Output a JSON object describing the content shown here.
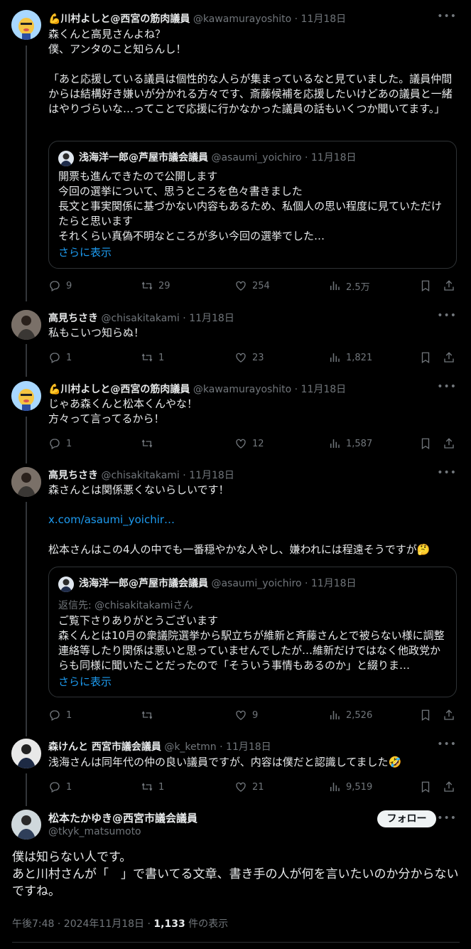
{
  "tweets": [
    {
      "emoji": "💪",
      "name": "川村よしと@西宮の筋肉議員",
      "handle": "@kawamurayoshito",
      "date": "11月18日",
      "text": "森くんと高見さんよね？\n僕、アンタのこと知らんし！\n\n「あと応援している議員は個性的な人らが集まっているなと見ていました。議員仲間からは結構好き嫌いが分かれる方々です、斎藤候補を応援したいけどあの議員と一緒はやりづらいな…ってことで応援に行かなかった議員の話もいくつか聞いてます。」",
      "quote": {
        "name": "浅海洋一郎@芦屋市議会議員",
        "handle": "@asaumi_yoichiro",
        "date": "11月18日",
        "text": "開票も進んできたので公開します\n今回の選挙について、思うところを色々書きました\n長文と事実関係に基づかない内容もあるため、私個人の思い程度に見ていただけたらと思います\nそれくらい真偽不明なところが多い今回の選挙でした…",
        "show_more": "さらに表示"
      },
      "stats": {
        "replies": "9",
        "retweets": "29",
        "likes": "254",
        "views": "2.5万"
      }
    },
    {
      "name": "高見ちさき",
      "handle": "@chisakitakami",
      "date": "11月18日",
      "text": "私もこいつ知らぬ！",
      "stats": {
        "replies": "1",
        "retweets": "1",
        "likes": "23",
        "views": "1,821"
      }
    },
    {
      "emoji": "💪",
      "name": "川村よしと@西宮の筋肉議員",
      "handle": "@kawamurayoshito",
      "date": "11月18日",
      "text": "じゃあ森くんと松本くんやな！\n方々って言ってるから！",
      "stats": {
        "replies": "1",
        "retweets": "",
        "likes": "12",
        "views": "1,587"
      }
    },
    {
      "name": "高見ちさき",
      "handle": "@chisakitakami",
      "date": "11月18日",
      "text": "森さんとは関係悪くないらしいです！",
      "link": "x.com/asaumi_yoichir…",
      "text2": "松本さんはこの4人の中でも一番穏やかな人やし、嫌われには程遠そうですが🤔",
      "quote": {
        "name": "浅海洋一郎@芦屋市議会議員",
        "handle": "@asaumi_yoichiro",
        "date": "11月18日",
        "reply_to": "返信先: @chisakitakamiさん",
        "text": "ご覧下さりありがとうございます\n森くんとは10月の衆議院選挙から駅立ちが維新と斉藤さんとで被らない様に調整連絡等したり関係は悪いと思っていませんでしたが…維新だけではなく他政党からも同様に聞いたことだったので「そういう事情もあるのか」と綴りま…",
        "show_more": "さらに表示"
      },
      "stats": {
        "replies": "1",
        "retweets": "",
        "likes": "9",
        "views": "2,526"
      }
    },
    {
      "name": "森けんと 西宮市議会議員",
      "handle": "@k_ketmn",
      "date": "11月18日",
      "text": "浅海さんは同年代の仲の良い議員ですが、内容は僕だと認識してました🤣",
      "stats": {
        "replies": "1",
        "retweets": "1",
        "likes": "21",
        "views": "9,519"
      }
    }
  ],
  "main": {
    "name": "松本たかゆき@西宮市議会議員",
    "handle": "@tkyk_matsumoto",
    "follow_label": "フォロー",
    "text": "僕は知らない人です。\nあと川村さんが「　」で書いてる文章、書き手の人が何を言いたいのか分からないですね。",
    "time": "午後7:48 · 2024年11月18日 · ",
    "views_count": "1,133",
    "views_suffix": " 件の表示"
  },
  "more_icon": "more-icon",
  "colors": {
    "accent": "#1d9bf0",
    "muted": "#71767b",
    "border": "#2f3336"
  }
}
